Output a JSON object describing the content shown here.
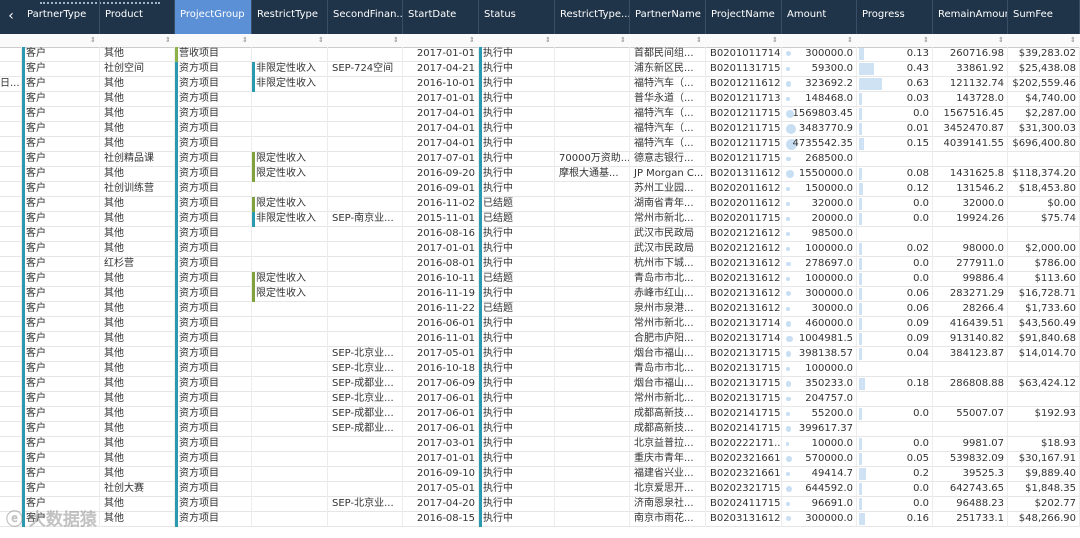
{
  "nav": {
    "prev_icon": "‹"
  },
  "columns": [
    "PartnerType",
    "Product",
    "ProjectGroup",
    "RestrictType",
    "SecondFinan...",
    "StartDate",
    "Status",
    "RestrictType...",
    "PartnerName",
    "ProjectName",
    "Amount",
    "Progress",
    "RemainAmount",
    "SumFee"
  ],
  "active_column": "ProjectGroup",
  "left_fragments": [
    "",
    "",
    "日...",
    "",
    "",
    "",
    "",
    "",
    "",
    "",
    "",
    "",
    "",
    "",
    "",
    "",
    "",
    "",
    "",
    "",
    "",
    "",
    "",
    "",
    "",
    "",
    "",
    "",
    "",
    "",
    "",
    "",
    ""
  ],
  "rows": [
    {
      "pt": "客户",
      "prod": "其他",
      "pg": "营收项目",
      "rt": "",
      "sf": "",
      "sd": "2017-01-01",
      "st": "执行中",
      "rt2": "",
      "pn": "首都民间组...",
      "proj": "B0201011714...",
      "amt": "300000.0",
      "prog": "0.13",
      "remain": "260716.98",
      "fee": "$39,283.02",
      "pgc": "g"
    },
    {
      "pt": "客户",
      "prod": "社创空间",
      "pg": "资方项目",
      "rt": "非限定性收入",
      "sf": "SEP-724空间",
      "sd": "2017-04-21",
      "st": "执行中",
      "rt2": "",
      "pn": "浦东新区民...",
      "proj": "B0201131715...",
      "amt": "59300.0",
      "prog": "0.43",
      "remain": "33861.92",
      "fee": "$25,438.08",
      "pgc": "t"
    },
    {
      "pt": "客户",
      "prod": "其他",
      "pg": "资方项目",
      "rt": "非限定性收入",
      "sf": "",
      "sd": "2016-10-01",
      "st": "执行中",
      "rt2": "",
      "pn": "福特汽车（...",
      "proj": "B0201211612...",
      "amt": "323692.2",
      "prog": "0.63",
      "remain": "121132.74",
      "fee": "$202,559.46",
      "pgc": "t"
    },
    {
      "pt": "客户",
      "prod": "其他",
      "pg": "资方项目",
      "rt": "",
      "sf": "",
      "sd": "2017-01-01",
      "st": "执行中",
      "rt2": "",
      "pn": "普华永道（...",
      "proj": "B0201211713...",
      "amt": "148468.0",
      "prog": "0.03",
      "remain": "143728.0",
      "fee": "$4,740.00",
      "pgc": "t"
    },
    {
      "pt": "客户",
      "prod": "其他",
      "pg": "资方项目",
      "rt": "",
      "sf": "",
      "sd": "2017-04-01",
      "st": "执行中",
      "rt2": "",
      "pn": "福特汽车（...",
      "proj": "B0201211715...",
      "amt": "1569803.45",
      "prog": "0.0",
      "remain": "1567516.45",
      "fee": "$2,287.00",
      "pgc": "t"
    },
    {
      "pt": "客户",
      "prod": "其他",
      "pg": "资方项目",
      "rt": "",
      "sf": "",
      "sd": "2017-04-01",
      "st": "执行中",
      "rt2": "",
      "pn": "福特汽车（...",
      "proj": "B0201211715...",
      "amt": "3483770.9",
      "prog": "0.01",
      "remain": "3452470.87",
      "fee": "$31,300.03",
      "pgc": "t"
    },
    {
      "pt": "客户",
      "prod": "其他",
      "pg": "资方项目",
      "rt": "",
      "sf": "",
      "sd": "2017-04-01",
      "st": "执行中",
      "rt2": "",
      "pn": "福特汽车（...",
      "proj": "B0201211715...",
      "amt": "4735542.35",
      "prog": "0.15",
      "remain": "4039141.55",
      "fee": "$696,400.80",
      "pgc": "t"
    },
    {
      "pt": "客户",
      "prod": "社创精品课",
      "pg": "资方项目",
      "rt": "限定性收入",
      "sf": "",
      "sd": "2017-07-01",
      "st": "执行中",
      "rt2": "70000万资助...",
      "pn": "德意志银行...",
      "proj": "B0201211715...",
      "amt": "268500.0",
      "prog": "",
      "remain": "",
      "fee": "",
      "pgc": "t"
    },
    {
      "pt": "客户",
      "prod": "其他",
      "pg": "资方项目",
      "rt": "限定性收入",
      "sf": "",
      "sd": "2016-09-20",
      "st": "执行中",
      "rt2": "摩根大通基...",
      "pn": "JP Morgan C...",
      "proj": "B0201311612...",
      "amt": "1550000.0",
      "prog": "0.08",
      "remain": "1431625.8",
      "fee": "$118,374.20",
      "pgc": "t"
    },
    {
      "pt": "客户",
      "prod": "社创训练营",
      "pg": "资方项目",
      "rt": "",
      "sf": "",
      "sd": "2016-09-01",
      "st": "执行中",
      "rt2": "",
      "pn": "苏州工业园...",
      "proj": "B0202011612...",
      "amt": "150000.0",
      "prog": "0.12",
      "remain": "131546.2",
      "fee": "$18,453.80",
      "pgc": "t"
    },
    {
      "pt": "客户",
      "prod": "其他",
      "pg": "资方项目",
      "rt": "限定性收入",
      "sf": "",
      "sd": "2016-11-02",
      "st": "已结题",
      "rt2": "",
      "pn": "湖南省青年...",
      "proj": "B0202011612...",
      "amt": "32000.0",
      "prog": "0.0",
      "remain": "32000.0",
      "fee": "$0.00",
      "pgc": "t"
    },
    {
      "pt": "客户",
      "prod": "其他",
      "pg": "资方项目",
      "rt": "非限定性收入",
      "sf": "SEP-南京业...",
      "sd": "2015-11-01",
      "st": "已结题",
      "rt2": "",
      "pn": "常州市新北...",
      "proj": "B0202011715...",
      "amt": "20000.0",
      "prog": "0.0",
      "remain": "19924.26",
      "fee": "$75.74",
      "pgc": "t"
    },
    {
      "pt": "客户",
      "prod": "其他",
      "pg": "资方项目",
      "rt": "",
      "sf": "",
      "sd": "2016-08-16",
      "st": "执行中",
      "rt2": "",
      "pn": "武汉市民政局",
      "proj": "B0202121612...",
      "amt": "98500.0",
      "prog": "",
      "remain": "",
      "fee": "",
      "pgc": "t"
    },
    {
      "pt": "客户",
      "prod": "其他",
      "pg": "资方项目",
      "rt": "",
      "sf": "",
      "sd": "2017-01-01",
      "st": "执行中",
      "rt2": "",
      "pn": "武汉市民政局",
      "proj": "B0202121612...",
      "amt": "100000.0",
      "prog": "0.02",
      "remain": "98000.0",
      "fee": "$2,000.00",
      "pgc": "t"
    },
    {
      "pt": "客户",
      "prod": "红杉营",
      "pg": "资方项目",
      "rt": "",
      "sf": "",
      "sd": "2016-08-01",
      "st": "执行中",
      "rt2": "",
      "pn": "杭州市下城...",
      "proj": "B0202131612...",
      "amt": "278697.0",
      "prog": "0.0",
      "remain": "277911.0",
      "fee": "$786.00",
      "pgc": "t"
    },
    {
      "pt": "客户",
      "prod": "其他",
      "pg": "资方项目",
      "rt": "限定性收入",
      "sf": "",
      "sd": "2016-10-11",
      "st": "已结题",
      "rt2": "",
      "pn": "青岛市市北...",
      "proj": "B0202131612...",
      "amt": "100000.0",
      "prog": "0.0",
      "remain": "99886.4",
      "fee": "$113.60",
      "pgc": "t"
    },
    {
      "pt": "客户",
      "prod": "其他",
      "pg": "资方项目",
      "rt": "限定性收入",
      "sf": "",
      "sd": "2016-11-19",
      "st": "执行中",
      "rt2": "",
      "pn": "赤峰市红山...",
      "proj": "B0202131612...",
      "amt": "300000.0",
      "prog": "0.06",
      "remain": "283271.29",
      "fee": "$16,728.71",
      "pgc": "t"
    },
    {
      "pt": "客户",
      "prod": "其他",
      "pg": "资方项目",
      "rt": "",
      "sf": "",
      "sd": "2016-11-22",
      "st": "已结题",
      "rt2": "",
      "pn": "泉州市泉港...",
      "proj": "B0202131612...",
      "amt": "30000.0",
      "prog": "0.06",
      "remain": "28266.4",
      "fee": "$1,733.60",
      "pgc": "t"
    },
    {
      "pt": "客户",
      "prod": "其他",
      "pg": "资方项目",
      "rt": "",
      "sf": "",
      "sd": "2016-06-01",
      "st": "执行中",
      "rt2": "",
      "pn": "常州市新北...",
      "proj": "B0202131714...",
      "amt": "460000.0",
      "prog": "0.09",
      "remain": "416439.51",
      "fee": "$43,560.49",
      "pgc": "t"
    },
    {
      "pt": "客户",
      "prod": "其他",
      "pg": "资方项目",
      "rt": "",
      "sf": "",
      "sd": "2016-11-01",
      "st": "执行中",
      "rt2": "",
      "pn": "合肥市庐阳...",
      "proj": "B0202131714...",
      "amt": "1004981.5",
      "prog": "0.09",
      "remain": "913140.82",
      "fee": "$91,840.68",
      "pgc": "t"
    },
    {
      "pt": "客户",
      "prod": "其他",
      "pg": "资方项目",
      "rt": "",
      "sf": "SEP-北京业...",
      "sd": "2017-05-01",
      "st": "执行中",
      "rt2": "",
      "pn": "烟台市福山...",
      "proj": "B0202131715...",
      "amt": "398138.57",
      "prog": "0.04",
      "remain": "384123.87",
      "fee": "$14,014.70",
      "pgc": "t"
    },
    {
      "pt": "客户",
      "prod": "其他",
      "pg": "资方项目",
      "rt": "",
      "sf": "SEP-北京业...",
      "sd": "2016-10-18",
      "st": "执行中",
      "rt2": "",
      "pn": "青岛市市北...",
      "proj": "B0202131715...",
      "amt": "100000.0",
      "prog": "",
      "remain": "",
      "fee": "",
      "pgc": "t"
    },
    {
      "pt": "客户",
      "prod": "其他",
      "pg": "资方项目",
      "rt": "",
      "sf": "SEP-成都业...",
      "sd": "2017-06-09",
      "st": "执行中",
      "rt2": "",
      "pn": "烟台市福山...",
      "proj": "B0202131715...",
      "amt": "350233.0",
      "prog": "0.18",
      "remain": "286808.88",
      "fee": "$63,424.12",
      "pgc": "t"
    },
    {
      "pt": "客户",
      "prod": "其他",
      "pg": "资方项目",
      "rt": "",
      "sf": "SEP-北京业...",
      "sd": "2017-06-01",
      "st": "执行中",
      "rt2": "",
      "pn": "常州市新北...",
      "proj": "B0202131715...",
      "amt": "204757.0",
      "prog": "",
      "remain": "",
      "fee": "",
      "pgc": "t"
    },
    {
      "pt": "客户",
      "prod": "其他",
      "pg": "资方项目",
      "rt": "",
      "sf": "SEP-成都业...",
      "sd": "2017-06-01",
      "st": "执行中",
      "rt2": "",
      "pn": "成都高新技...",
      "proj": "B0202141715...",
      "amt": "55200.0",
      "prog": "0.0",
      "remain": "55007.07",
      "fee": "$192.93",
      "pgc": "t"
    },
    {
      "pt": "客户",
      "prod": "其他",
      "pg": "资方项目",
      "rt": "",
      "sf": "SEP-成都业...",
      "sd": "2017-06-01",
      "st": "执行中",
      "rt2": "",
      "pn": "成都高新技...",
      "proj": "B0202141715...",
      "amt": "399617.37",
      "prog": "",
      "remain": "",
      "fee": "",
      "pgc": "t"
    },
    {
      "pt": "客户",
      "prod": "其他",
      "pg": "资方项目",
      "rt": "",
      "sf": "",
      "sd": "2017-03-01",
      "st": "执行中",
      "rt2": "",
      "pn": "北京益普拉...",
      "proj": "B020222171...",
      "amt": "10000.0",
      "prog": "0.0",
      "remain": "9981.07",
      "fee": "$18.93",
      "pgc": "t"
    },
    {
      "pt": "客户",
      "prod": "其他",
      "pg": "资方项目",
      "rt": "",
      "sf": "",
      "sd": "2017-01-01",
      "st": "执行中",
      "rt2": "",
      "pn": "重庆市青年...",
      "proj": "B0202321661...",
      "amt": "570000.0",
      "prog": "0.05",
      "remain": "539832.09",
      "fee": "$30,167.91",
      "pgc": "t"
    },
    {
      "pt": "客户",
      "prod": "其他",
      "pg": "资方项目",
      "rt": "",
      "sf": "",
      "sd": "2016-09-10",
      "st": "执行中",
      "rt2": "",
      "pn": "福建省兴业...",
      "proj": "B0202321661...",
      "amt": "49414.7",
      "prog": "0.2",
      "remain": "39525.3",
      "fee": "$9,889.40",
      "pgc": "t"
    },
    {
      "pt": "客户",
      "prod": "社创大赛",
      "pg": "资方项目",
      "rt": "",
      "sf": "",
      "sd": "2017-05-01",
      "st": "执行中",
      "rt2": "",
      "pn": "北京爱思开...",
      "proj": "B0202321715...",
      "amt": "644592.0",
      "prog": "0.0",
      "remain": "642743.65",
      "fee": "$1,848.35",
      "pgc": "t"
    },
    {
      "pt": "客户",
      "prod": "其他",
      "pg": "资方项目",
      "rt": "",
      "sf": "SEP-北京业...",
      "sd": "2017-04-20",
      "st": "执行中",
      "rt2": "",
      "pn": "济南恩泉社...",
      "proj": "B0202411715...",
      "amt": "96691.0",
      "prog": "0.0",
      "remain": "96488.23",
      "fee": "$202.77",
      "pgc": "t"
    },
    {
      "pt": "客户",
      "prod": "其他",
      "pg": "资方项目",
      "rt": "",
      "sf": "",
      "sd": "2016-08-15",
      "st": "执行中",
      "rt2": "",
      "pn": "南京市雨花...",
      "proj": "B0203131612...",
      "amt": "300000.0",
      "prog": "0.16",
      "remain": "251733.1",
      "fee": "$48,266.90",
      "pgc": "t"
    }
  ],
  "watermark": "大数据猿",
  "colors": {
    "header_bg": "#1f3349",
    "active_header": "#5b8fd6",
    "teal": "#2a9ab0",
    "green": "#8db24a"
  }
}
